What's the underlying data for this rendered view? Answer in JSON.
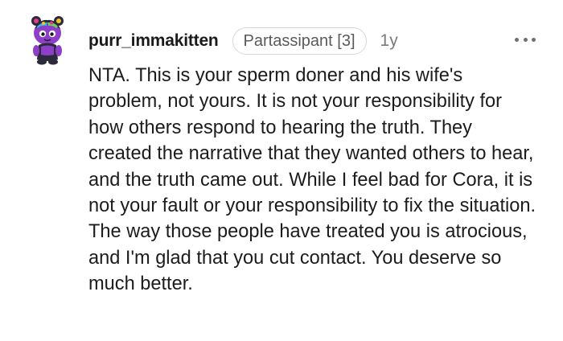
{
  "comment": {
    "username": "purr_immakitten",
    "flair": "Partassipant [3]",
    "age": "1y",
    "body": "NTA. This is your sperm doner and his wife's problem, not yours. It is not your responsibility for how others respond to hearing the truth. They created the narrative that they wanted others to hear, and the truth came out. While I feel bad for Cora, it is not your fault or your responsibility to fix the situation. The way those people have treated you is atrocious, and I'm glad that you cut contact. You deserve so much better."
  },
  "icons": {
    "avatar": "snoo-avatar-icon",
    "more": "more-options-icon"
  },
  "colors": {
    "text": "#1a1a1b",
    "meta": "#7a7a7a",
    "flair_border": "#d6d6d6",
    "avatar_body": "#8e3fc8",
    "avatar_dark": "#2a2a3a"
  }
}
